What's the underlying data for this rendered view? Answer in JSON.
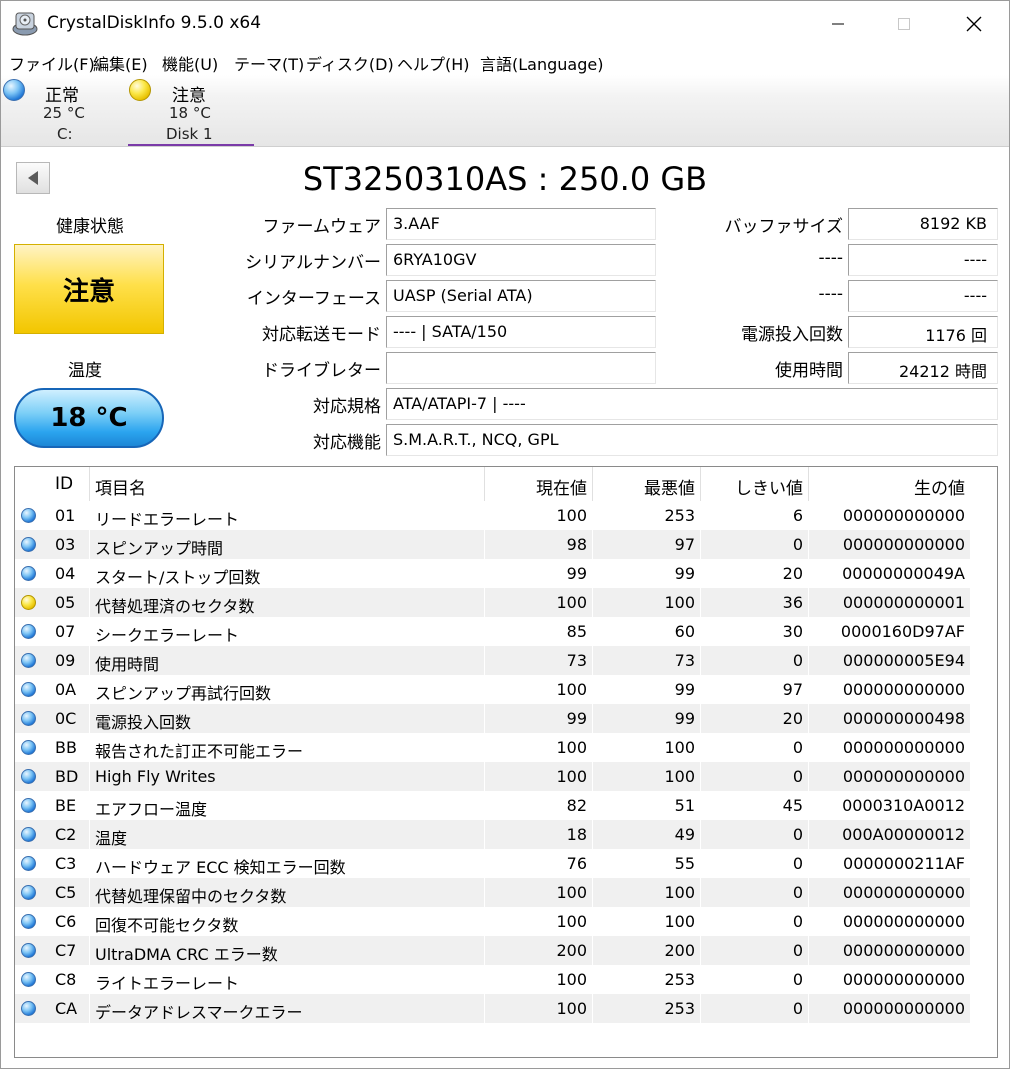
{
  "window": {
    "title": "CrystalDiskInfo 9.5.0 x64"
  },
  "menu": [
    "ファイル(F)",
    "編集(E)",
    "機能(U)",
    "テーマ(T)",
    "ディスク(D)",
    "ヘルプ(H)",
    "言語(Language)"
  ],
  "disk_tabs": [
    {
      "status": "正常",
      "temp": "25 °C",
      "name": "C:",
      "color": "#1f77d6"
    },
    {
      "status": "注意",
      "temp": "18 °C",
      "name": "Disk 1",
      "color": "#e8c000"
    }
  ],
  "drive": {
    "title": "ST3250310AS : 250.0 GB",
    "health_label": "健康状態",
    "health_value": "注意",
    "temp_label": "温度",
    "temp_value": "18 °C"
  },
  "info": {
    "firmware_label": "ファームウェア",
    "firmware": "3.AAF",
    "serial_label": "シリアルナンバー",
    "serial": "6RYA10GV",
    "interface_label": "インターフェース",
    "interface": "UASP (Serial ATA)",
    "transfer_label": "対応転送モード",
    "transfer": "---- | SATA/150",
    "letter_label": "ドライブレター",
    "letter": "",
    "standard_label": "対応規格",
    "standard": "ATA/ATAPI-7 | ----",
    "features_label": "対応機能",
    "features": "S.M.A.R.T., NCQ, GPL",
    "buffer_label": "バッファサイズ",
    "buffer": "8192 KB",
    "r2_label": "----",
    "r2": "----",
    "r3_label": "----",
    "r3": "----",
    "power_count_label": "電源投入回数",
    "power_count": "1176 回",
    "hours_label": "使用時間",
    "hours": "24212 時間"
  },
  "smart": {
    "headers": {
      "id": "ID",
      "name": "項目名",
      "current": "現在値",
      "worst": "最悪値",
      "threshold": "しきい値",
      "raw": "生の値"
    },
    "rows": [
      {
        "id": "01",
        "name": "リードエラーレート",
        "current": "100",
        "worst": "253",
        "threshold": "6",
        "raw": "000000000000",
        "color": "#1f77d6"
      },
      {
        "id": "03",
        "name": "スピンアップ時間",
        "current": "98",
        "worst": "97",
        "threshold": "0",
        "raw": "000000000000",
        "color": "#1f77d6"
      },
      {
        "id": "04",
        "name": "スタート/ストップ回数",
        "current": "99",
        "worst": "99",
        "threshold": "20",
        "raw": "00000000049A",
        "color": "#1f77d6"
      },
      {
        "id": "05",
        "name": "代替処理済のセクタ数",
        "current": "100",
        "worst": "100",
        "threshold": "36",
        "raw": "000000000001",
        "color": "#e8c000"
      },
      {
        "id": "07",
        "name": "シークエラーレート",
        "current": "85",
        "worst": "60",
        "threshold": "30",
        "raw": "0000160D97AF",
        "color": "#1f77d6"
      },
      {
        "id": "09",
        "name": "使用時間",
        "current": "73",
        "worst": "73",
        "threshold": "0",
        "raw": "000000005E94",
        "color": "#1f77d6"
      },
      {
        "id": "0A",
        "name": "スピンアップ再試行回数",
        "current": "100",
        "worst": "99",
        "threshold": "97",
        "raw": "000000000000",
        "color": "#1f77d6"
      },
      {
        "id": "0C",
        "name": "電源投入回数",
        "current": "99",
        "worst": "99",
        "threshold": "20",
        "raw": "000000000498",
        "color": "#1f77d6"
      },
      {
        "id": "BB",
        "name": "報告された訂正不可能エラー",
        "current": "100",
        "worst": "100",
        "threshold": "0",
        "raw": "000000000000",
        "color": "#1f77d6"
      },
      {
        "id": "BD",
        "name": "High Fly Writes",
        "current": "100",
        "worst": "100",
        "threshold": "0",
        "raw": "000000000000",
        "color": "#1f77d6"
      },
      {
        "id": "BE",
        "name": "エアフロー温度",
        "current": "82",
        "worst": "51",
        "threshold": "45",
        "raw": "0000310A0012",
        "color": "#1f77d6"
      },
      {
        "id": "C2",
        "name": "温度",
        "current": "18",
        "worst": "49",
        "threshold": "0",
        "raw": "000A00000012",
        "color": "#1f77d6"
      },
      {
        "id": "C3",
        "name": "ハードウェア ECC 検知エラー回数",
        "current": "76",
        "worst": "55",
        "threshold": "0",
        "raw": "0000000211AF",
        "color": "#1f77d6"
      },
      {
        "id": "C5",
        "name": "代替処理保留中のセクタ数",
        "current": "100",
        "worst": "100",
        "threshold": "0",
        "raw": "000000000000",
        "color": "#1f77d6"
      },
      {
        "id": "C6",
        "name": "回復不可能セクタ数",
        "current": "100",
        "worst": "100",
        "threshold": "0",
        "raw": "000000000000",
        "color": "#1f77d6"
      },
      {
        "id": "C7",
        "name": "UltraDMA CRC エラー数",
        "current": "200",
        "worst": "200",
        "threshold": "0",
        "raw": "000000000000",
        "color": "#1f77d6"
      },
      {
        "id": "C8",
        "name": "ライトエラーレート",
        "current": "100",
        "worst": "253",
        "threshold": "0",
        "raw": "000000000000",
        "color": "#1f77d6"
      },
      {
        "id": "CA",
        "name": "データアドレスマークエラー",
        "current": "100",
        "worst": "253",
        "threshold": "0",
        "raw": "000000000000",
        "color": "#1f77d6"
      }
    ]
  }
}
